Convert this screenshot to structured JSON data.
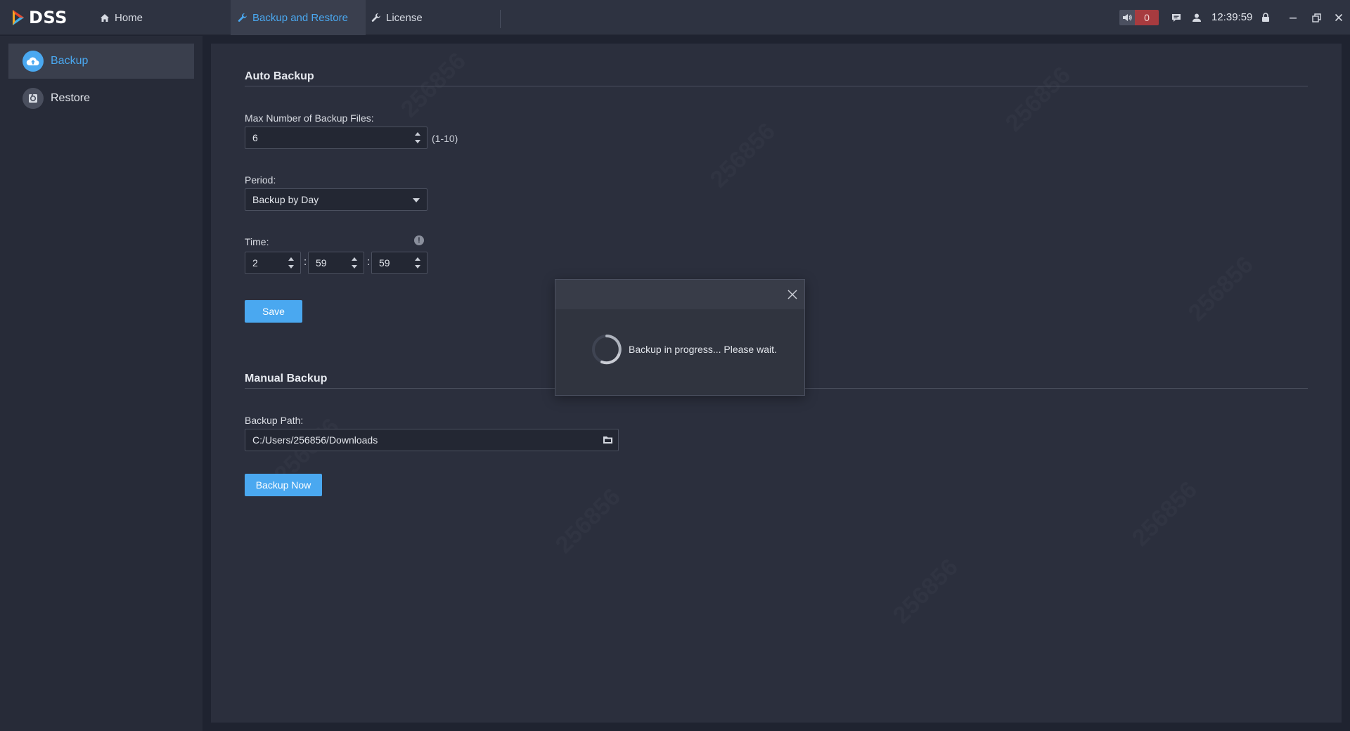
{
  "app": {
    "logo_text": "DSS",
    "tabs": [
      {
        "label": "Home"
      },
      {
        "label": "Backup and Restore"
      },
      {
        "label": "License"
      }
    ],
    "alarm_count": "0",
    "clock": "12:39:59",
    "accent_color": "#4aa8f0",
    "alarm_color": "#a73b3f"
  },
  "sidebar": {
    "items": [
      {
        "label": "Backup",
        "icon": "cloud-upload-icon"
      },
      {
        "label": "Restore",
        "icon": "restore-icon"
      }
    ]
  },
  "auto_backup": {
    "title": "Auto Backup",
    "max_files_label": "Max Number of Backup Files:",
    "max_files_value": "6",
    "max_files_hint": "(1-10)",
    "period_label": "Period:",
    "period_value": "Backup by Day",
    "time_label": "Time:",
    "time_hour": "2",
    "time_minute": "59",
    "time_second": "59",
    "time_separator": ":",
    "save_label": "Save"
  },
  "manual_backup": {
    "title": "Manual Backup",
    "path_label": "Backup Path:",
    "path_value": "C:/Users/256856/Downloads",
    "backup_now_label": "Backup Now"
  },
  "modal": {
    "message": "Backup in progress... Please wait."
  },
  "watermark": "256856"
}
